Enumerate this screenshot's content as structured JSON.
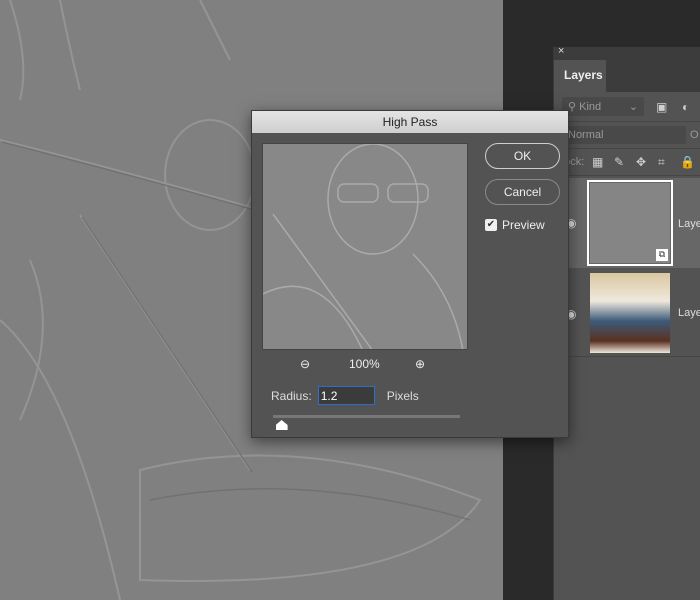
{
  "dialog": {
    "title": "High Pass",
    "ok": "OK",
    "cancel": "Cancel",
    "preview_label": "Preview",
    "preview_checked": true,
    "zoom_level": "100%",
    "radius_label": "Radius:",
    "radius_value": "1.2",
    "radius_unit": "Pixels",
    "radius_slider_fraction": 0.03
  },
  "layers_panel": {
    "close": "×",
    "tab": "Layers",
    "filter_placeholder": "Kind",
    "blend_mode": "Normal",
    "opacity_label": "O",
    "lock_label": "Lock:",
    "layers": [
      {
        "name": "Layer",
        "thumbnail": "high-pass-gray",
        "selected": true
      },
      {
        "name": "Layer",
        "thumbnail": "photo-violin-maker",
        "selected": false
      }
    ]
  },
  "colors": {
    "canvas": "#808080",
    "panel": "#535353",
    "accent": "#2d6fc8"
  }
}
